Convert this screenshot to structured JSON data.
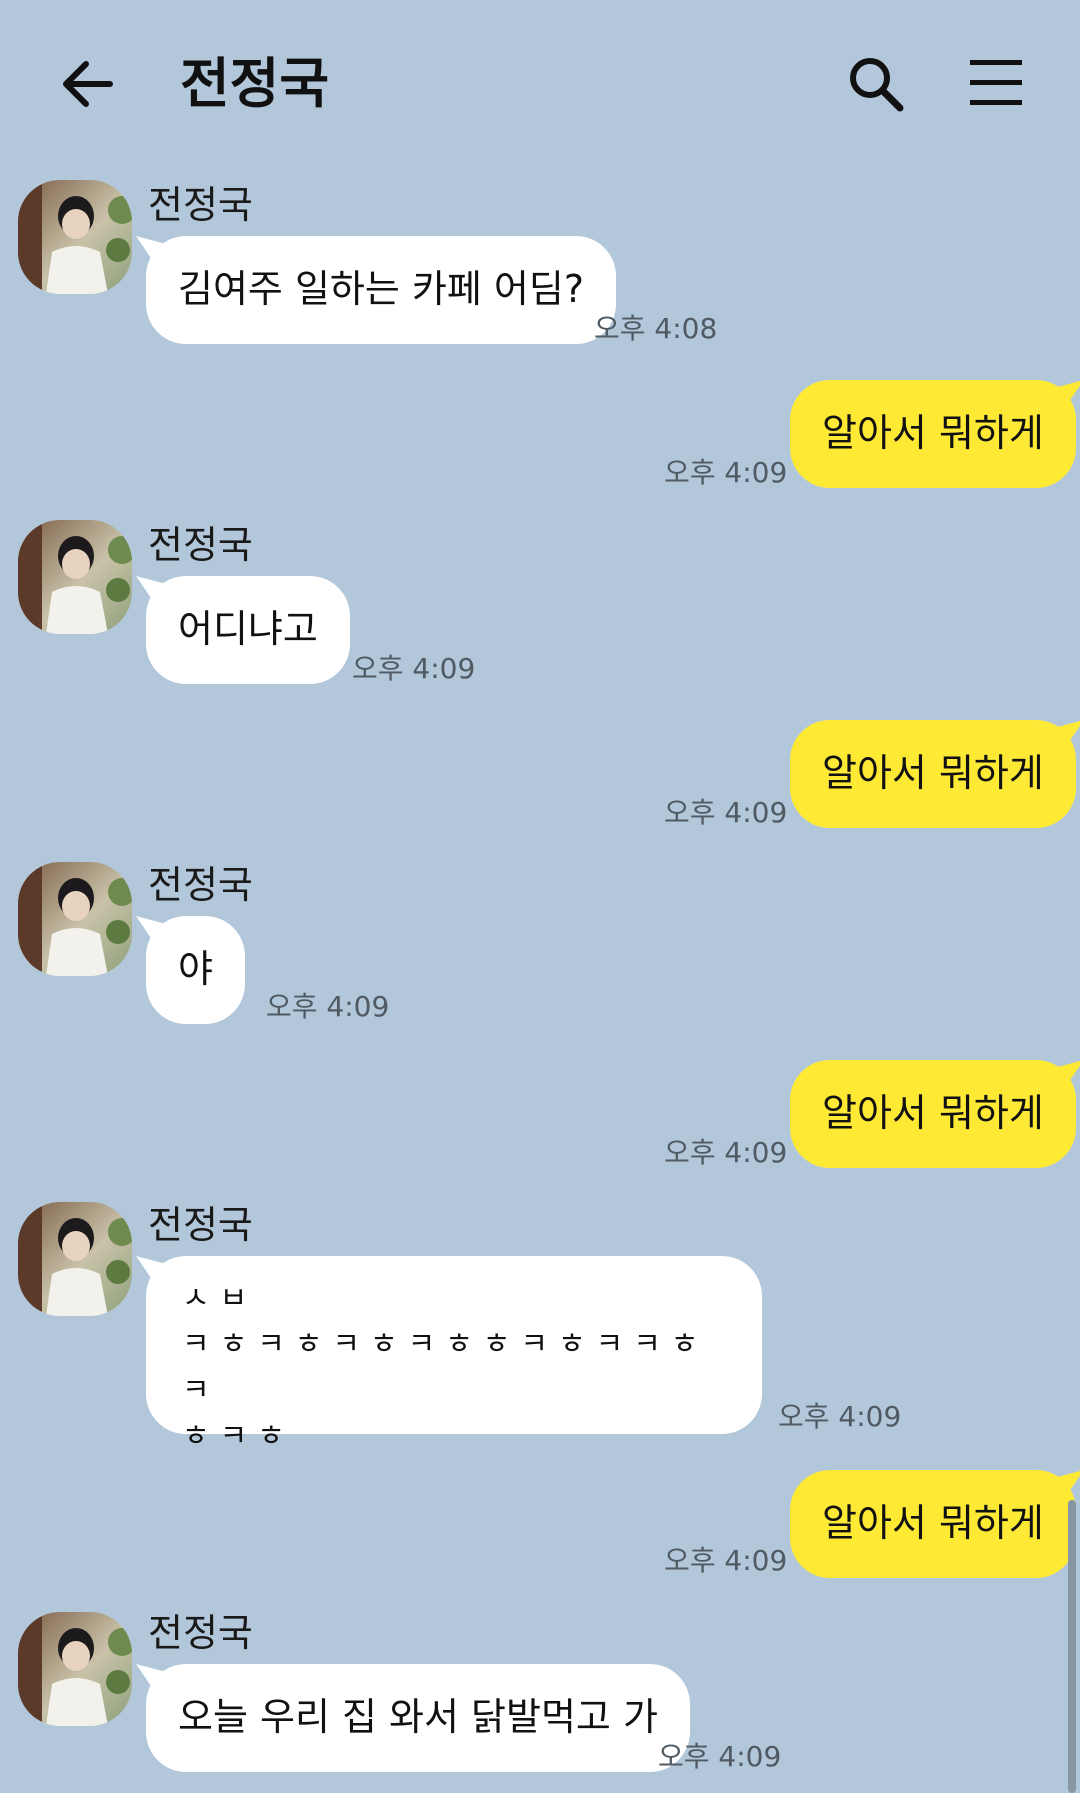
{
  "header": {
    "title": "전정국",
    "back_icon": "arrow-left-icon",
    "search_icon": "search-icon",
    "menu_icon": "hamburger-menu-icon"
  },
  "colors": {
    "background": "#b2c7da",
    "incoming_bubble": "#ffffff",
    "outgoing_bubble": "#fee934"
  },
  "messages": [
    {
      "direction": "in",
      "sender": "전정국",
      "text": "김여주 일하는 카페 어딤?",
      "time": "오후 4:08"
    },
    {
      "direction": "out",
      "text": "알아서 뭐하게",
      "time": "오후 4:09"
    },
    {
      "direction": "in",
      "sender": "전정국",
      "text": "어디냐고",
      "time": "오후 4:09"
    },
    {
      "direction": "out",
      "text": "알아서 뭐하게",
      "time": "오후 4:09"
    },
    {
      "direction": "in",
      "sender": "전정국",
      "text": "야",
      "time": "오후 4:09"
    },
    {
      "direction": "out",
      "text": "알아서 뭐하게",
      "time": "오후 4:09"
    },
    {
      "direction": "in",
      "sender": "전정국",
      "lines": [
        "ㅅㅂ",
        "ㅋㅎㅋㅎㅋㅎㅋㅎㅎㅋㅎㅋㅋㅎㅋ",
        "ㅎㅋㅎ"
      ],
      "time": "오후 4:09"
    },
    {
      "direction": "out",
      "text": "알아서 뭐하게",
      "time": "오후 4:09"
    },
    {
      "direction": "in",
      "sender": "전정국",
      "text": "오늘 우리 집 와서 닭발먹고 가",
      "time": "오후 4:09"
    }
  ]
}
